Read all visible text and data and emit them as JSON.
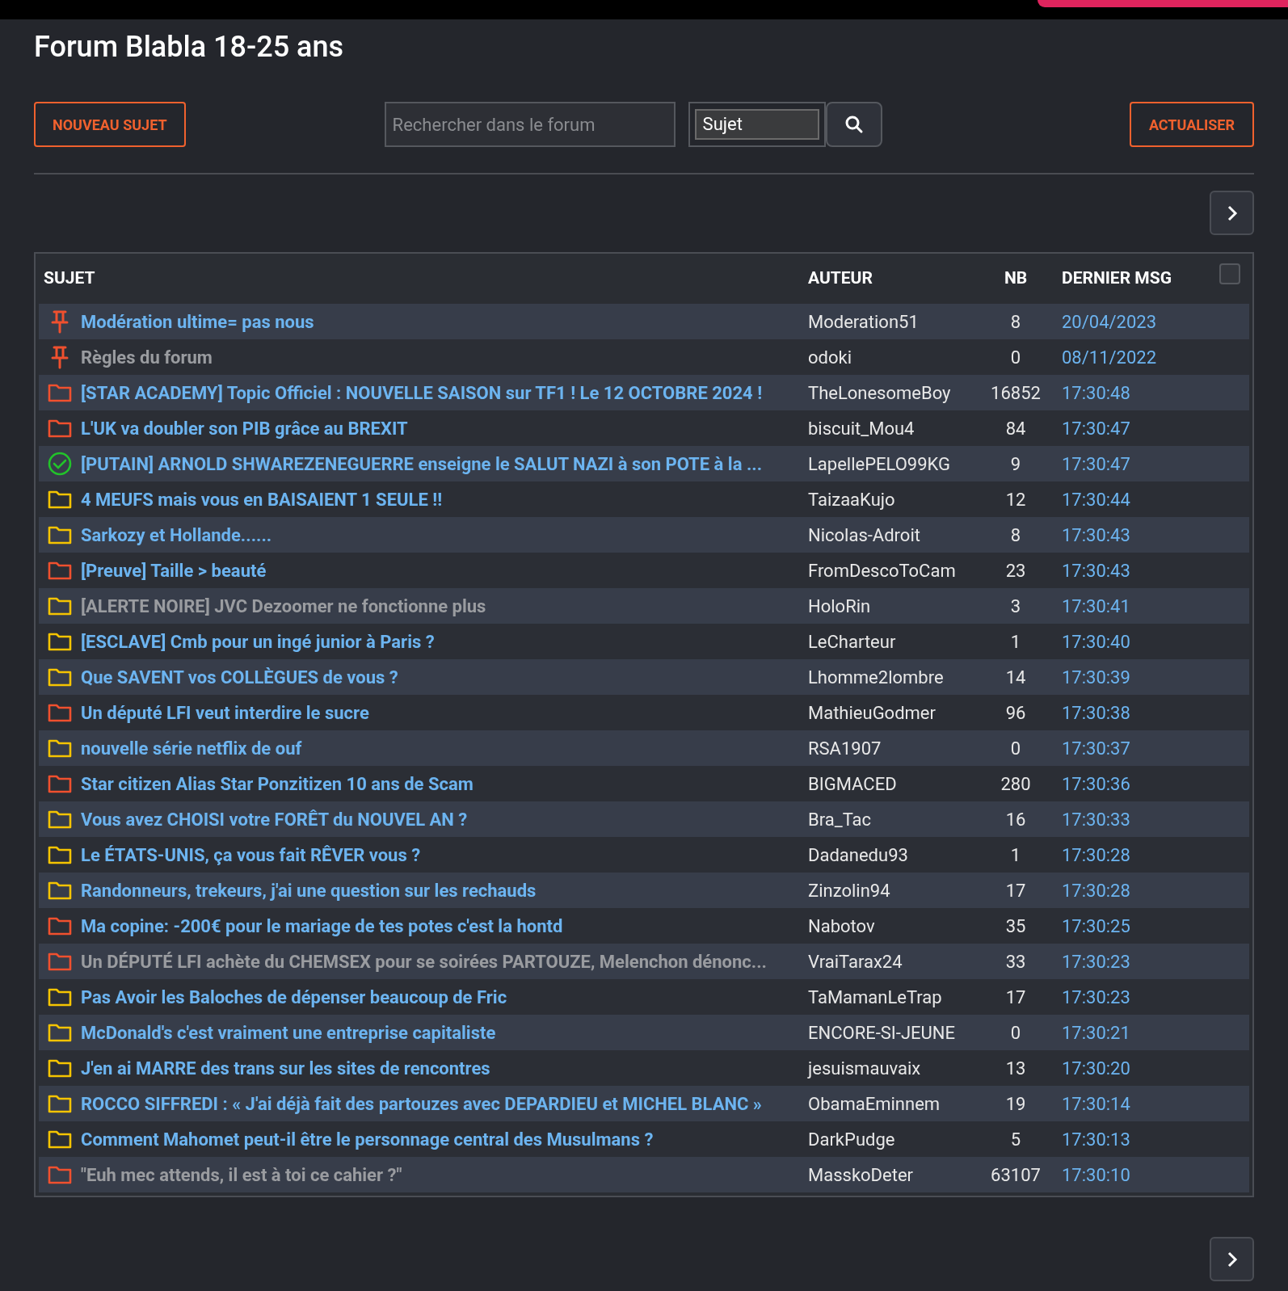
{
  "title": "Forum Blabla 18-25 ans",
  "toolbar": {
    "new_topic": "NOUVEAU SUJET",
    "search": {
      "placeholder": "Rechercher dans le forum"
    },
    "search_scope": "Sujet",
    "refresh": "ACTUALISER"
  },
  "table": {
    "columns": [
      "SUJET",
      "AUTEUR",
      "NB",
      "DERNIER MSG"
    ],
    "select_all": {
      "checked": false
    },
    "rows": [
      {
        "kind": "pinned",
        "subject": "Modération ultime= pas nous",
        "read": false,
        "author": "Moderation51",
        "count": "8",
        "last": "20/04/2023"
      },
      {
        "kind": "pinned",
        "subject": "Règles du forum",
        "read": true,
        "author": "odoki",
        "count": "0",
        "last": "08/11/2022"
      },
      {
        "kind": "hot",
        "subject": "[STAR ACADEMY] Topic Officiel : NOUVELLE SAISON sur TF1 ! Le 12 OCTOBRE 2024 !",
        "read": false,
        "author": "TheLonesomeBoy",
        "count": "16852",
        "last": "17:30:48"
      },
      {
        "kind": "hot",
        "subject": "L'UK va doubler son PIB grâce au BREXIT",
        "read": false,
        "author": "biscuit_Mou4",
        "count": "84",
        "last": "17:30:47"
      },
      {
        "kind": "resolved",
        "subject": "[PUTAIN] ARNOLD SHWAREZENEGUERRE enseigne le SALUT NAZI à son POTE à la ...",
        "read": false,
        "author": "LapellePELO99KG",
        "count": "9",
        "last": "17:30:47"
      },
      {
        "kind": "normal",
        "subject": "4 MEUFS mais vous en BAISAIENT 1 SEULE !!",
        "read": false,
        "author": "TaizaaKujo",
        "count": "12",
        "last": "17:30:44"
      },
      {
        "kind": "normal",
        "subject": "Sarkozy et Hollande......",
        "read": false,
        "author": "Nicolas-Adroit",
        "count": "8",
        "last": "17:30:43"
      },
      {
        "kind": "hot",
        "subject": "[Preuve] Taille > beauté",
        "read": false,
        "author": "FromDescoToCam",
        "count": "23",
        "last": "17:30:43"
      },
      {
        "kind": "normal",
        "subject": "[ALERTE NOIRE] JVC Dezoomer ne fonctionne plus",
        "read": true,
        "author": "HoloRin",
        "count": "3",
        "last": "17:30:41"
      },
      {
        "kind": "normal",
        "subject": "[ESCLAVE] Cmb pour un ingé junior à Paris ?",
        "read": false,
        "author": "LeCharteur",
        "count": "1",
        "last": "17:30:40"
      },
      {
        "kind": "normal",
        "subject": "Que SAVENT vos COLLÈGUES de vous ?",
        "read": false,
        "author": "Lhomme2lombre",
        "count": "14",
        "last": "17:30:39"
      },
      {
        "kind": "hot",
        "subject": "Un député LFI veut interdire le sucre",
        "read": false,
        "author": "MathieuGodmer",
        "count": "96",
        "last": "17:30:38"
      },
      {
        "kind": "normal",
        "subject": "nouvelle série netflix de ouf",
        "read": false,
        "author": "RSA1907",
        "count": "0",
        "last": "17:30:37"
      },
      {
        "kind": "hot",
        "subject": "Star citizen Alias Star Ponzitizen 10 ans de Scam",
        "read": false,
        "author": "BIGMACED",
        "count": "280",
        "last": "17:30:36"
      },
      {
        "kind": "normal",
        "subject": "Vous avez CHOISI votre FORÊT du NOUVEL AN ?",
        "read": false,
        "author": "Bra_Tac",
        "count": "16",
        "last": "17:30:33"
      },
      {
        "kind": "normal",
        "subject": "Le ÉTATS-UNIS, ça vous fait RÊVER vous ?",
        "read": false,
        "author": "Dadanedu93",
        "count": "1",
        "last": "17:30:28"
      },
      {
        "kind": "normal",
        "subject": "Randonneurs, trekeurs, j'ai une question sur les rechauds",
        "read": false,
        "author": "Zinzolin94",
        "count": "17",
        "last": "17:30:28"
      },
      {
        "kind": "hot",
        "subject": "Ma copine: -200€ pour le mariage de tes potes c'est la hontd",
        "read": false,
        "author": "Nabotov",
        "count": "35",
        "last": "17:30:25"
      },
      {
        "kind": "hot",
        "subject": "Un DÉPUTÉ LFI achète du CHEMSEX pour se soirées PARTOUZE, Melenchon dénonc...",
        "read": true,
        "author": "VraiTarax24",
        "count": "33",
        "last": "17:30:23"
      },
      {
        "kind": "normal",
        "subject": "Pas Avoir les Baloches de dépenser beaucoup de Fric",
        "read": false,
        "author": "TaMamanLeTrap",
        "count": "17",
        "last": "17:30:23"
      },
      {
        "kind": "normal",
        "subject": "McDonald's c'est vraiment une entreprise capitaliste",
        "read": false,
        "author": "ENCORE-SI-JEUNE",
        "count": "0",
        "last": "17:30:21"
      },
      {
        "kind": "normal",
        "subject": "J'en ai MARRE des trans sur les sites de rencontres",
        "read": false,
        "author": "jesuismauvaix",
        "count": "13",
        "last": "17:30:20"
      },
      {
        "kind": "normal",
        "subject": "ROCCO SIFFREDI : « J'ai déjà fait des partouzes avec DEPARDIEU et MICHEL BLANC »",
        "read": false,
        "author": "ObamaEminnem",
        "count": "19",
        "last": "17:30:14"
      },
      {
        "kind": "normal",
        "subject": "Comment Mahomet peut-il être le personnage central des Musulmans ?",
        "read": false,
        "author": "DarkPudge",
        "count": "5",
        "last": "17:30:13"
      },
      {
        "kind": "hot",
        "subject": "\"Euh mec attends, il est à toi ce cahier ?\"",
        "read": true,
        "author": "MasskoDeter",
        "count": "63107",
        "last": "17:30:10"
      }
    ]
  }
}
